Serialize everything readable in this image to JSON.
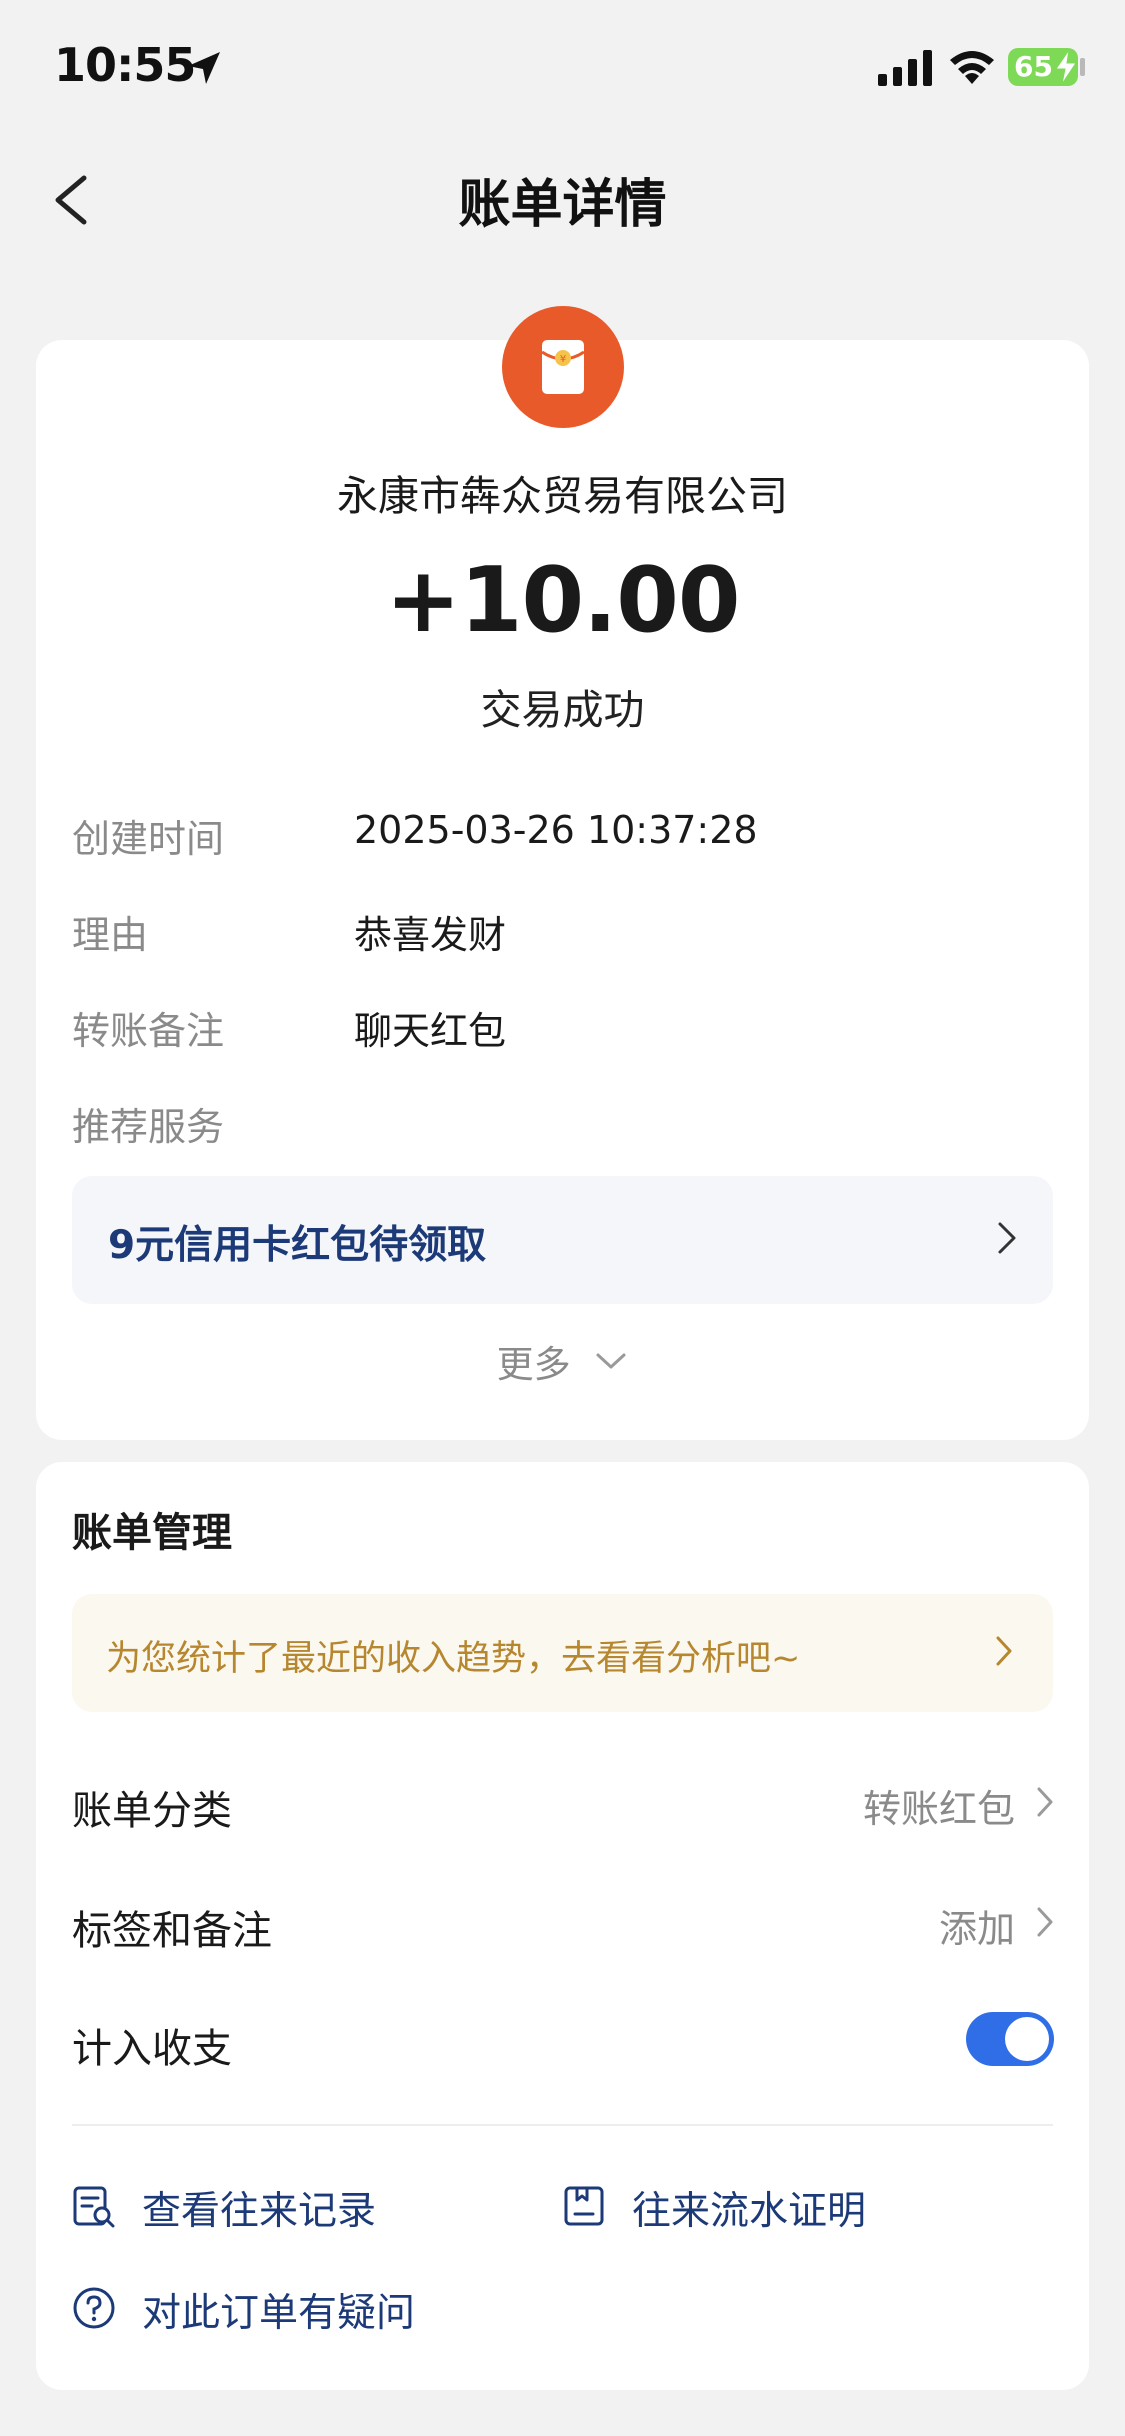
{
  "status_bar": {
    "time": "10:55",
    "battery": "65"
  },
  "nav": {
    "title": "账单详情",
    "back_icon": "chevron-left-icon"
  },
  "transaction": {
    "payer": "永康市犇众贸易有限公司",
    "amount": "+10.00",
    "status": "交易成功",
    "icon": "red-packet-icon",
    "icon_color": "#e95a2a"
  },
  "details": [
    {
      "label": "创建时间",
      "value": "2025-03-26 10:37:28"
    },
    {
      "label": "理由",
      "value": "恭喜发财"
    },
    {
      "label": "转账备注",
      "value": "聊天红包"
    },
    {
      "label": "推荐服务",
      "value": ""
    }
  ],
  "promo": {
    "text": "9元信用卡红包待领取"
  },
  "more": {
    "label": "更多"
  },
  "manage": {
    "title": "账单管理",
    "tip": "为您统计了最近的收入趋势，去看看分析吧~",
    "rows": [
      {
        "label": "账单分类",
        "value": "转账红包"
      },
      {
        "label": "标签和备注",
        "value": "添加"
      },
      {
        "label": "计入收支",
        "toggle_on": true
      }
    ],
    "links": [
      {
        "label": "查看往来记录",
        "icon": "record-search-icon"
      },
      {
        "label": "往来流水证明",
        "icon": "certificate-icon"
      },
      {
        "label": "对此订单有疑问",
        "icon": "question-circle-icon"
      }
    ]
  },
  "colors": {
    "accent": "#2f6ee6",
    "link": "#1d3a78",
    "tip_text": "#b7872f",
    "background": "#f2f2f2"
  }
}
